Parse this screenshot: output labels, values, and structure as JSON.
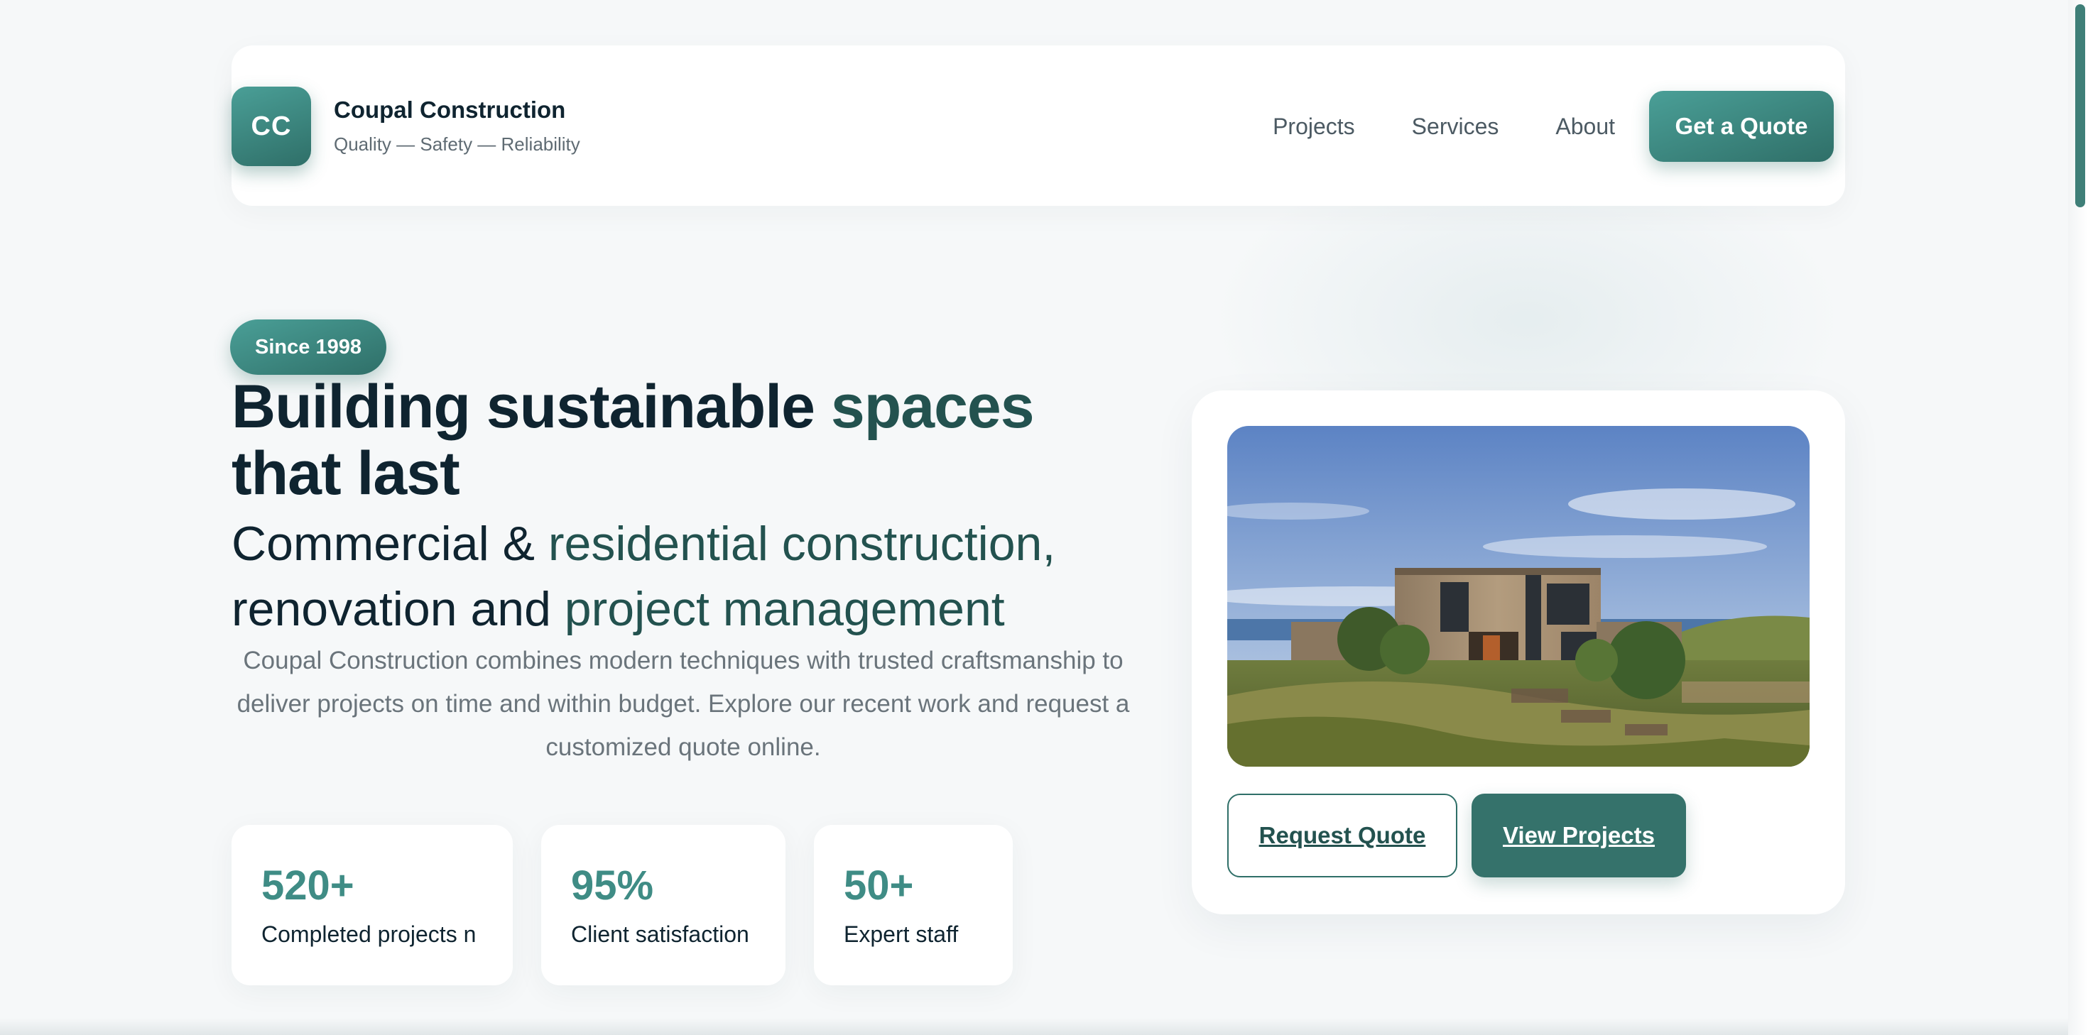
{
  "header": {
    "logo_text": "CC",
    "brand_name": "Coupal Construction",
    "tagline": "Quality — Safety — Reliability",
    "nav": [
      "Projects",
      "Services",
      "About"
    ],
    "cta_label": "Get a Quote"
  },
  "hero": {
    "badge": "Since 1998",
    "title_part1": "Building sustainable ",
    "title_part2": "spaces",
    "title_part3": "that last",
    "subtitle_part1": "Commercial & ",
    "subtitle_part2": "residential construction,",
    "subtitle_part3": "renovation and ",
    "subtitle_part4": "project management",
    "description": "Coupal Construction combines modern techniques with trusted craftsmanship to deliver projects on time and within budget. Explore our recent work and request a customized quote online."
  },
  "stats": [
    {
      "value": "520+",
      "label": "Completed projects n"
    },
    {
      "value": "95%",
      "label": "Client satisfaction"
    },
    {
      "value": "50+",
      "label": "Expert staff"
    }
  ],
  "card": {
    "request_label": "Request Quote",
    "view_label": "View Projects"
  },
  "colors": {
    "accent": "#3f8c85",
    "accent_dark": "#2f6f68",
    "heading": "#0f2430",
    "background": "#f6f8f9"
  }
}
